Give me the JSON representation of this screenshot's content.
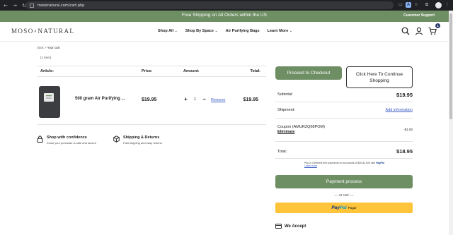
{
  "browser": {
    "url": "mosonatural.com/cart.php"
  },
  "announcement": {
    "message": "Free Shipping on All Orders within the US",
    "support": "Customer Support"
  },
  "header": {
    "logo": "MOSO",
    "logo_suffix": "NATURAL",
    "nav": [
      {
        "label": "Shop All",
        "has_caret": true
      },
      {
        "label": "Shop By Space",
        "has_caret": true
      },
      {
        "label": "Air Purifying Bags",
        "has_caret": false
      },
      {
        "label": "Learn More",
        "has_caret": true
      }
    ],
    "cart_count": "1"
  },
  "breadcrumb": {
    "home": "Start",
    "separator": ">",
    "current": "Your cart"
  },
  "cart": {
    "items_count": "(1 item)",
    "columns": {
      "article": "Article:",
      "price": "Price:",
      "amount": "Amount:",
      "total": "Total:"
    },
    "items": [
      {
        "name": "500 gram Air Purifying ...",
        "price": "$19.95",
        "quantity": "1",
        "remove": "Remove",
        "total": "$19.95"
      }
    ]
  },
  "features": [
    {
      "icon": "lock-icon",
      "title": "Shop with confidence",
      "desc": "Know your purchase is safe and secure"
    },
    {
      "icon": "box-icon",
      "title": "Shipping & Returns",
      "desc": "Fast shipping and easy returns"
    }
  ],
  "summary": {
    "checkout": "Proceed to Checkout",
    "continue": "Click Here To Continue Shopping",
    "subtotal_label": "Subtotal:",
    "subtotal": "$19.95",
    "shipment_label": "Shipment:",
    "shipment_link": "Add information",
    "coupon_label": "Coupon (AMURZQ68POM)",
    "coupon_remove": "Eliminate",
    "coupon_value": "-$1.00",
    "total_label": "Total:",
    "total": "$18.95",
    "paylater_text": "Pay in 4 interest-free payments on purchases of $30-$1,500 with",
    "paylater_brand": "PayPal",
    "paylater_link": "Learn more",
    "payment_process": "Payment process",
    "or_use": "— or use —",
    "paypal_pay": "Pay",
    "paypal_pal": "Pal",
    "paypal_suffix": "Pagar",
    "we_accept": "We Accept"
  },
  "colors": {
    "brand_green": "#6e8e64",
    "link_blue": "#3b5bc5",
    "paypal_yellow": "#ffc439",
    "badge_navy": "#2a3c6b"
  }
}
